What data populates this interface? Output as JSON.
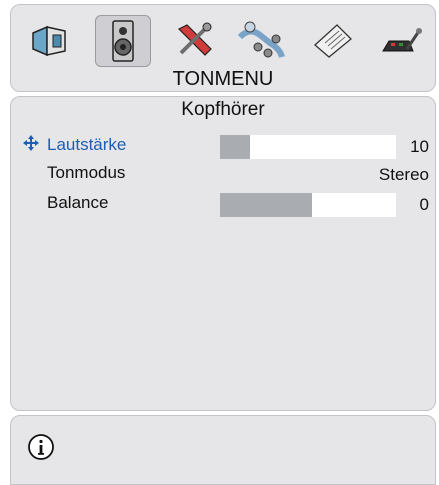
{
  "top_menu": {
    "title": "TONMENU",
    "icons": [
      {
        "name": "picture-icon",
        "selected": false
      },
      {
        "name": "speaker-icon",
        "selected": true
      },
      {
        "name": "settings-tools-icon",
        "selected": false
      },
      {
        "name": "source-connections-icon",
        "selected": false
      },
      {
        "name": "teletext-icon",
        "selected": false
      },
      {
        "name": "installation-icon",
        "selected": false
      }
    ]
  },
  "submenu": {
    "title": "Kopfhörer",
    "rows": [
      {
        "label": "Lautstärke",
        "value": "10",
        "slider_fraction": 0.17,
        "active": true
      },
      {
        "label": "Tonmodus",
        "value": "Stereo",
        "active": false
      },
      {
        "label": "Balance",
        "value": "0",
        "slider_fraction": 0.52,
        "active": false
      }
    ]
  },
  "colors": {
    "panel": "#e6e6e8",
    "accent": "#1a5fb4",
    "slider_fill": "#a9acb1"
  },
  "info": {
    "icon": "info-icon"
  }
}
